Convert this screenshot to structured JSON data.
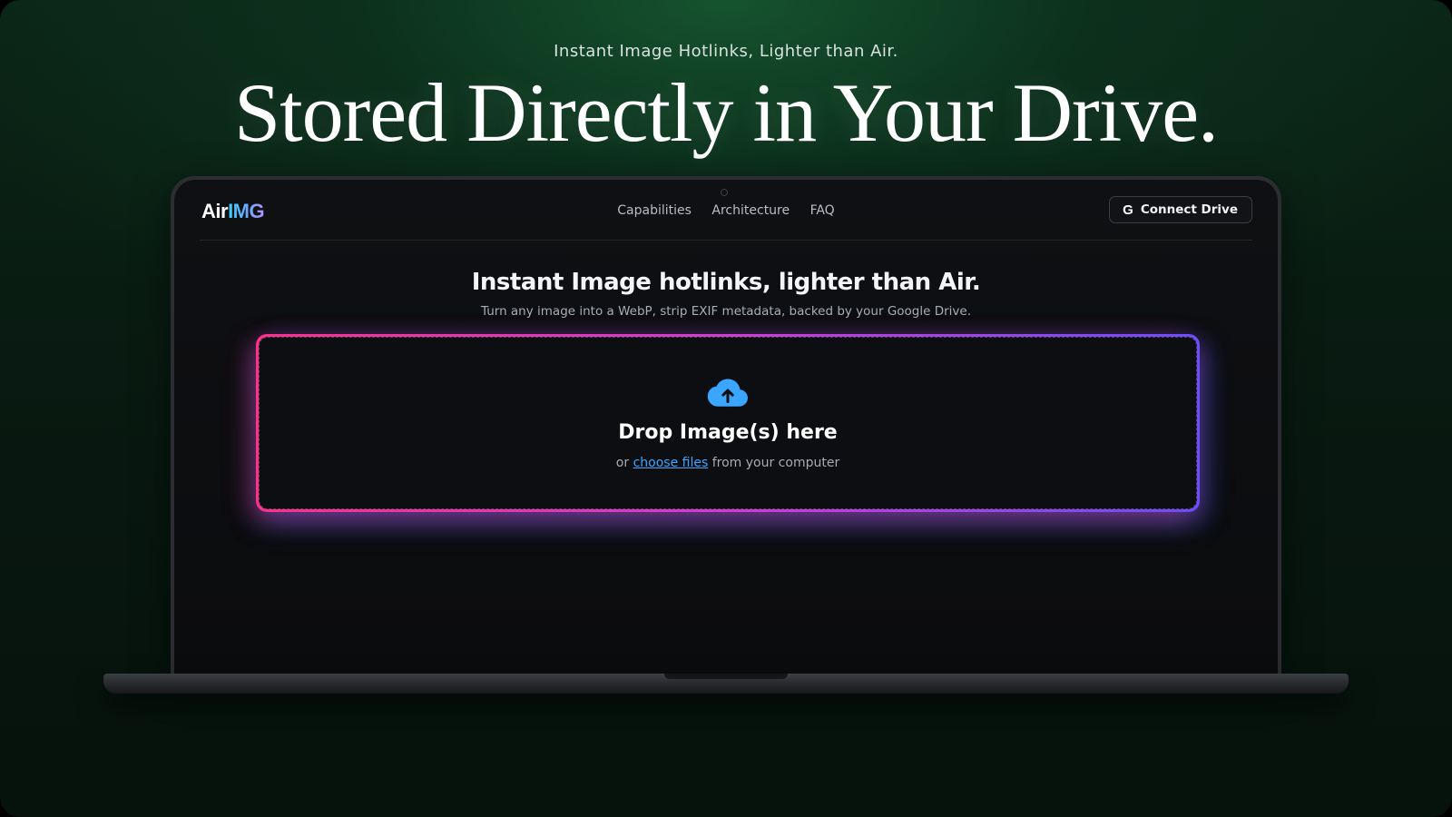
{
  "hero": {
    "kicker": "Instant Image Hotlinks, Lighter than Air.",
    "headline": "Stored Directly in Your Drive."
  },
  "app": {
    "logo": {
      "primary": "Air",
      "accent": "IMG"
    },
    "nav": {
      "links": [
        "Capabilities",
        "Architecture",
        "FAQ"
      ],
      "connect_button": {
        "icon": "google-g-icon",
        "glyph": "G",
        "label": "Connect Drive"
      }
    },
    "main": {
      "title": "Instant Image hotlinks, lighter than Air.",
      "subtitle": "Turn any image into a WebP, strip EXIF metadata, backed by your Google Drive.",
      "dropzone": {
        "icon": "cloud-upload-icon",
        "title": "Drop Image(s) here",
        "prefix": "or ",
        "link": "choose files",
        "suffix": " from your computer"
      }
    }
  },
  "colors": {
    "background": "#0b2416",
    "screen": "#0d0e11",
    "gradient_start": "#ff2f8e",
    "gradient_end": "#6d4bff",
    "link": "#3aa6ff",
    "cloud_icon": "#3aa6ff"
  }
}
